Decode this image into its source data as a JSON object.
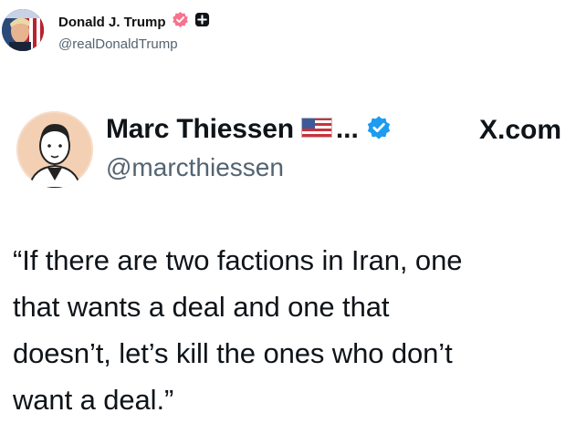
{
  "outer_post": {
    "author_name": "Donald J. Trump",
    "author_handle": "@realDonaldTrump",
    "colors": {
      "badge_pink": "#f6738e",
      "badge_dark": "#0f1419"
    }
  },
  "quoted_card": {
    "author_name": "Marc Thiessen",
    "ellipsis": "...",
    "author_handle": "@marcthiessen",
    "source": "X.com",
    "colors": {
      "verified_blue": "#1d9bf0"
    },
    "quote_lines": [
      "“If there are two factions in Iran, one",
      "that wants a deal and one that",
      "doesn’t, let’s kill the ones who don’t",
      "want a deal.”"
    ]
  }
}
